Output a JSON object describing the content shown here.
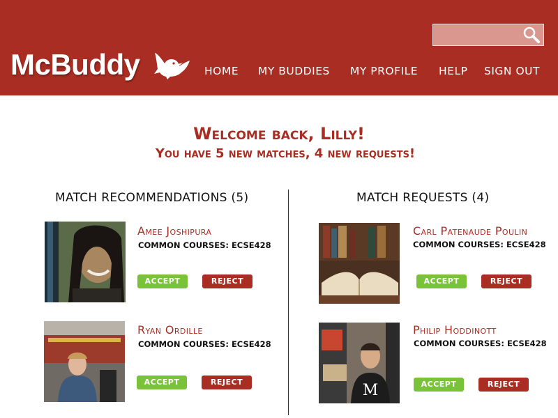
{
  "header": {
    "logo": "McBuddy",
    "search": {
      "placeholder": "",
      "value": ""
    },
    "nav": [
      "HOME",
      "MY BUDDIES",
      "MY PROFILE",
      "HELP",
      "SIGN OUT"
    ]
  },
  "welcome": {
    "title": "Welcome back, Lilly!",
    "subtitle": "You have 5 new matches, 4 new requests!"
  },
  "recommendations": {
    "title": "MATCH RECOMMENDATIONS (5)",
    "items": [
      {
        "name": "Amee Joshipura",
        "courses": "COMMON COURSES: ECSE428",
        "accept": "ACCEPT",
        "reject": "REJECT"
      },
      {
        "name": "Ryan Ordille",
        "courses": "COMMON COURSES: ECSE428",
        "accept": "ACCEPT",
        "reject": "REJECT"
      }
    ]
  },
  "requests": {
    "title": "MATCH REQUESTS (4)",
    "items": [
      {
        "name": "Carl Patenaude Poulin",
        "courses": "COMMON COURSES: ECSE428",
        "accept": "ACCEPT",
        "reject": "REJECT"
      },
      {
        "name": "Philip Hoddinott",
        "courses": "COMMON COURSES: ECSE428",
        "accept": "ACCEPT",
        "reject": "REJECT"
      }
    ]
  },
  "colors": {
    "brand": "#a92d22",
    "accept": "#7ac23a",
    "reject": "#a92d22"
  }
}
